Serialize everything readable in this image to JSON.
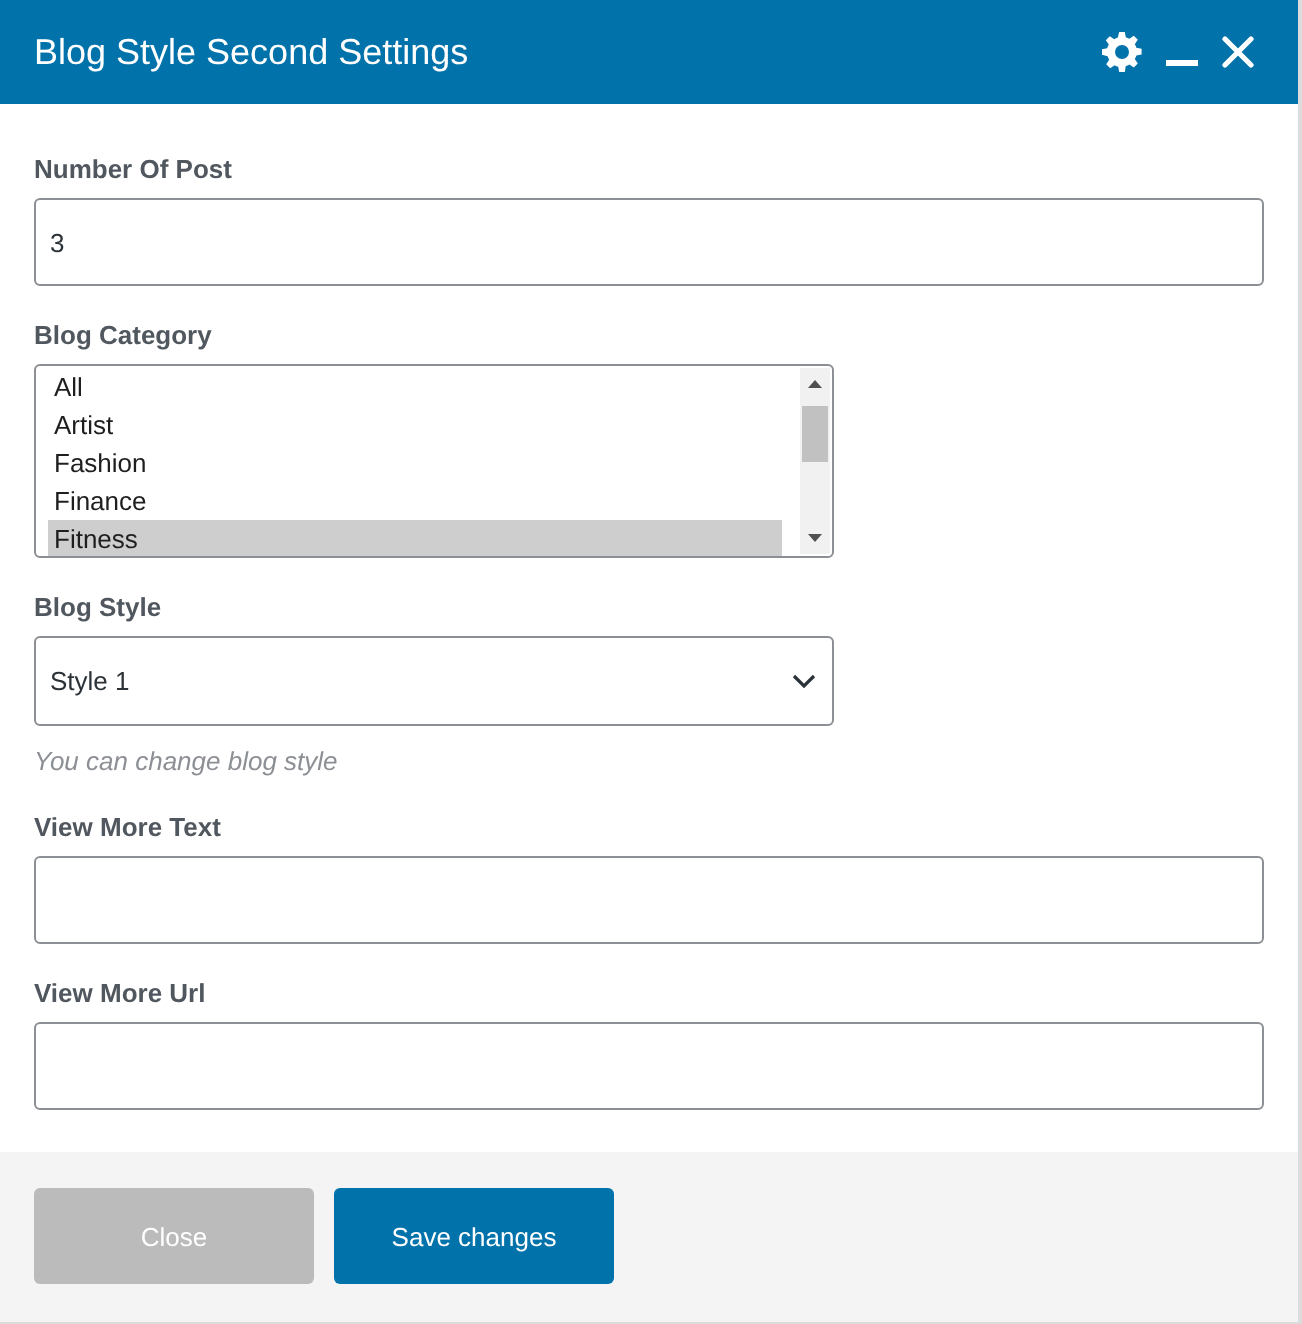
{
  "window": {
    "title": "Blog Style Second Settings"
  },
  "fields": [
    {
      "kind": "text",
      "label": "Number Of Post",
      "value": "3"
    },
    {
      "kind": "listbox",
      "label": "Blog Category",
      "options": [
        {
          "label": "All",
          "selected": false
        },
        {
          "label": "Artist",
          "selected": false
        },
        {
          "label": "Fashion",
          "selected": false
        },
        {
          "label": "Finance",
          "selected": false
        },
        {
          "label": "Fitness",
          "selected": true
        }
      ]
    },
    {
      "kind": "select",
      "label": "Blog Style",
      "value": "Style 1",
      "hint": "You can change blog style"
    },
    {
      "kind": "text",
      "label": "View More Text"
    },
    {
      "kind": "text",
      "label": "View More Url"
    }
  ],
  "buttons": [
    {
      "kind": "secondary",
      "label": "Close"
    },
    {
      "kind": "primary",
      "label": "Save changes"
    }
  ]
}
